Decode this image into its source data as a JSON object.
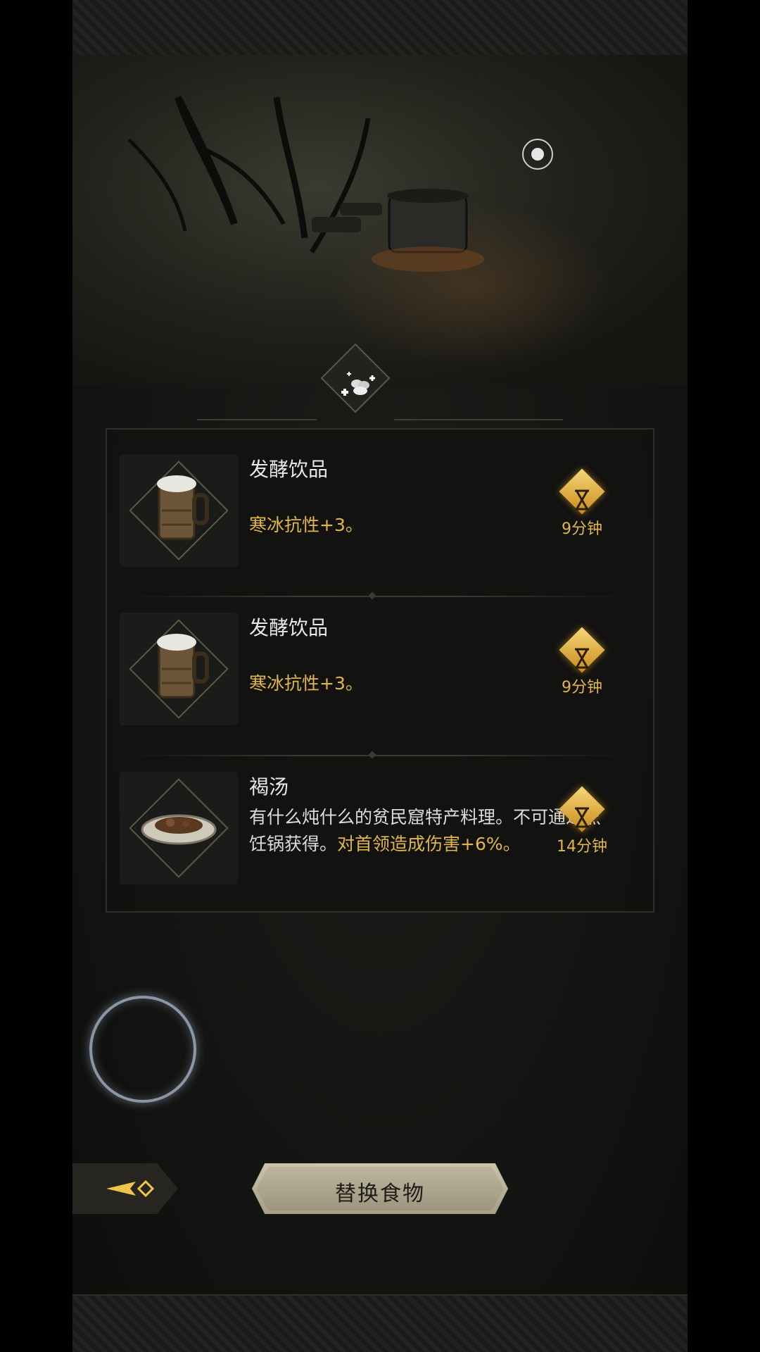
{
  "header": {
    "record_icon": "record-dot-icon",
    "category_icon": "food-plus-icon"
  },
  "food_items": [
    {
      "name": "发酵饮品",
      "desc_plain": "",
      "desc_bonus": "寒冰抗性+3。",
      "time": "9分钟",
      "icon": "beer-mug-icon"
    },
    {
      "name": "发酵饮品",
      "desc_plain": "",
      "desc_bonus": "寒冰抗性+3。",
      "time": "9分钟",
      "icon": "beer-mug-icon"
    },
    {
      "name": "褐汤",
      "desc_plain": "有什么炖什么的贫民窟特产料理。不可通过烹饪锅获得。",
      "desc_bonus": "对首领造成伤害+6%。",
      "time": "14分钟",
      "icon": "stew-plate-icon"
    }
  ],
  "buttons": {
    "replace_label": "替换食物",
    "back_icon": "back-arrow-icon"
  },
  "colors": {
    "bonus": "#e1b74a",
    "timer_badge": "#f0c040",
    "button_face": "#bdb59d"
  }
}
